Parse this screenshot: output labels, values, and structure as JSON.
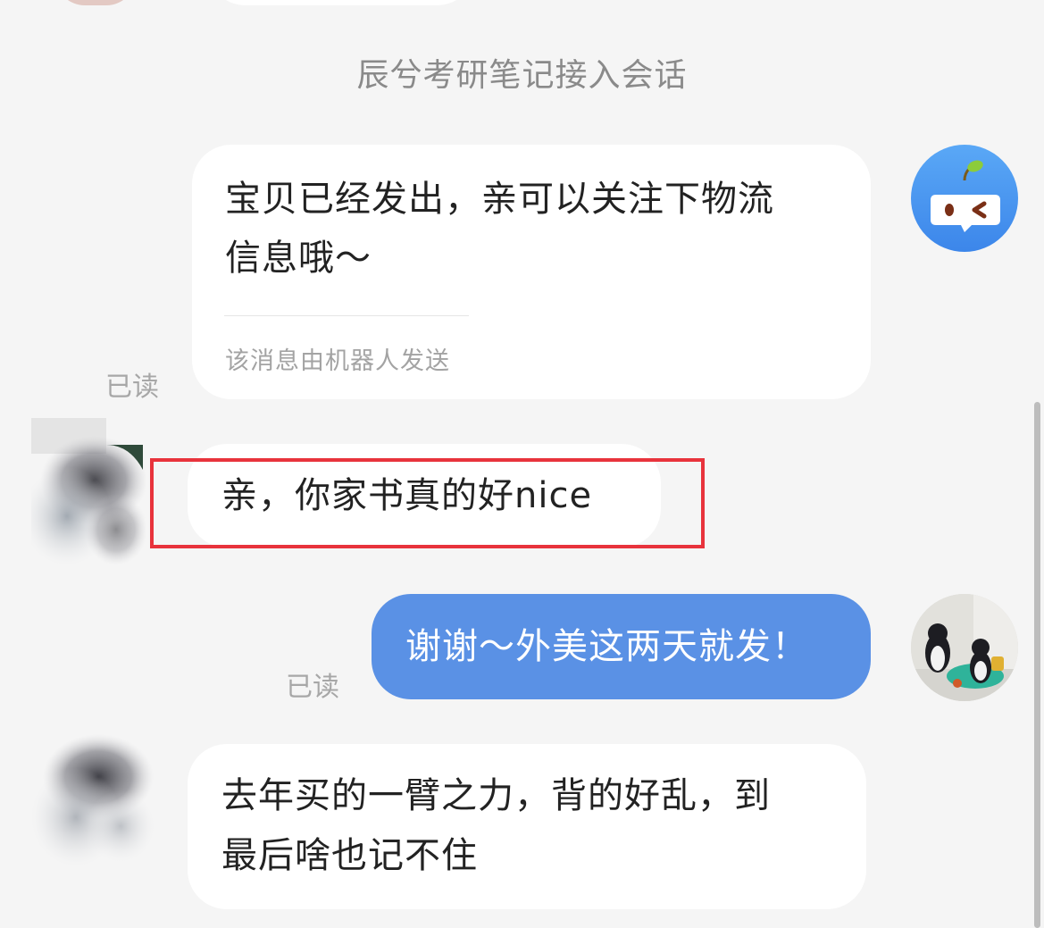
{
  "colors": {
    "background": "#f5f5f5",
    "bubble_self": "#5a91e5",
    "bubble_other": "#ffffff",
    "highlight_border": "#e8333c"
  },
  "system_notice": "辰兮考研笔记接入会话",
  "messages": [
    {
      "from": "robot",
      "text_line1": "宝贝已经发出，亲可以关注下物流",
      "text_line2": "信息哦～",
      "note": "该消息由机器人发送",
      "status": "已读",
      "avatar_icon": "robot-avatar-icon"
    },
    {
      "from": "customer",
      "text": "亲，你家书真的好nice",
      "highlighted": true,
      "avatar_icon": "cloud-ink-avatar-icon"
    },
    {
      "from": "self",
      "text": "谢谢～外美这两天就发！",
      "status": "已读",
      "avatar_icon": "penguin-toys-avatar-icon"
    },
    {
      "from": "customer",
      "text_line1": "去年买的一臂之力，背的好乱，到",
      "text_line2": "最后啥也记不住",
      "avatar_icon": "cloud-ink-avatar-icon"
    }
  ]
}
